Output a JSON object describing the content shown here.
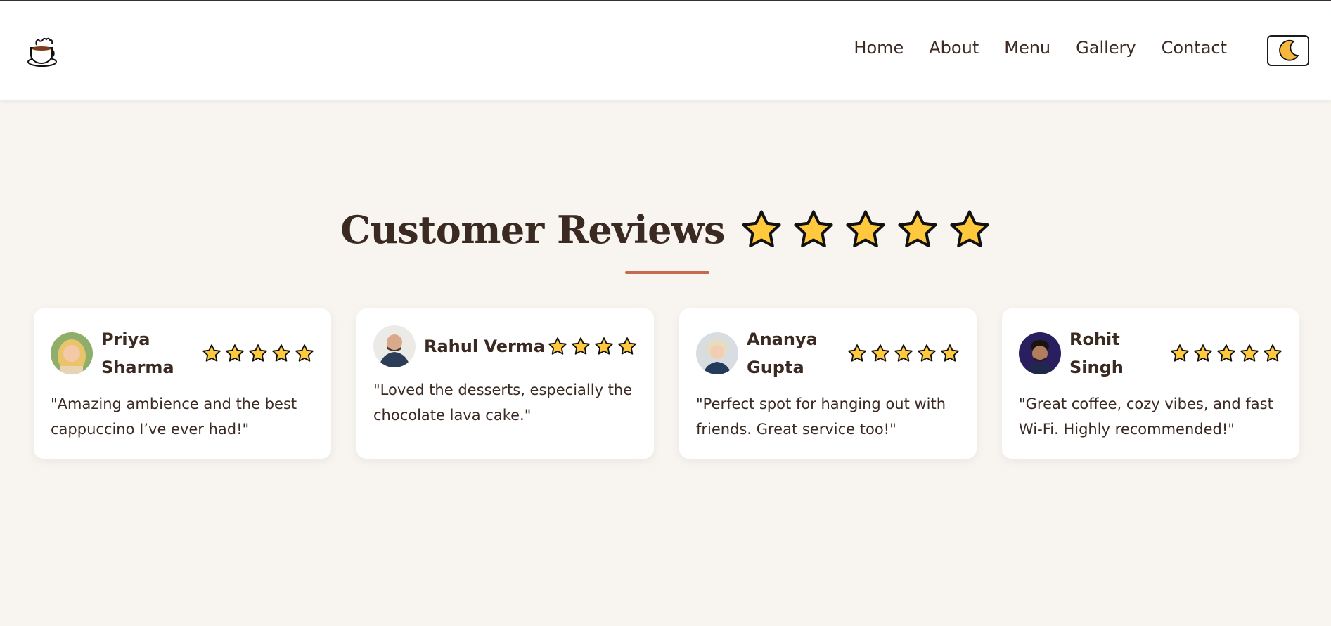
{
  "nav": {
    "items": [
      "Home",
      "About",
      "Menu",
      "Gallery",
      "Contact"
    ],
    "theme_icon": "crescent-moon-icon",
    "logo_icon": "coffee-cup-icon"
  },
  "section": {
    "title": "Customer Reviews",
    "title_stars": 5
  },
  "reviews": [
    {
      "name": "Priya Sharma",
      "rating": 5,
      "quote": "\"Amazing ambience and the best cappuccino I’ve ever had!\""
    },
    {
      "name": "Rahul Verma",
      "rating": 4,
      "quote": "\"Loved the desserts, especially the chocolate lava cake.\""
    },
    {
      "name": "Ananya Gupta",
      "rating": 5,
      "quote": "\"Perfect spot for hanging out with friends. Great service too!\""
    },
    {
      "name": "Rohit Singh",
      "rating": 5,
      "quote": "\"Great coffee, cozy vibes, and fast Wi-Fi. Highly recommended!\""
    }
  ],
  "colors": {
    "background": "#f8f5f1",
    "text": "#3b2a22",
    "accent": "#c46a4f",
    "star": "#ffc83d"
  }
}
